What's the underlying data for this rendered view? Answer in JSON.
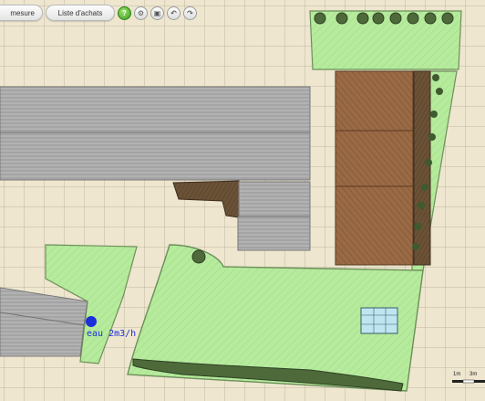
{
  "toolbar": {
    "tab_mesure": "mesure",
    "tab_achats": "Liste d'achats",
    "help_button": "?",
    "buttons": [
      {
        "icon": "settings-icon",
        "glyph": "⚙"
      },
      {
        "icon": "print-icon",
        "glyph": "▣"
      },
      {
        "icon": "undo-icon",
        "glyph": "↶"
      },
      {
        "icon": "redo-icon",
        "glyph": "↷"
      }
    ]
  },
  "plan": {
    "water_point_label": "eau 2m3/h",
    "scale": {
      "left": "1m",
      "right": "3m"
    }
  },
  "colors": {
    "background": "#eee6cf",
    "lawn": "#b6eb9d",
    "lawn_stroke": "#6d8f5a",
    "path": "#a6a6a6",
    "soil": "#9a6a45",
    "mulch": "#6b5237",
    "hedge": "#4e6a3a",
    "water_point": "#1c2fd8"
  }
}
